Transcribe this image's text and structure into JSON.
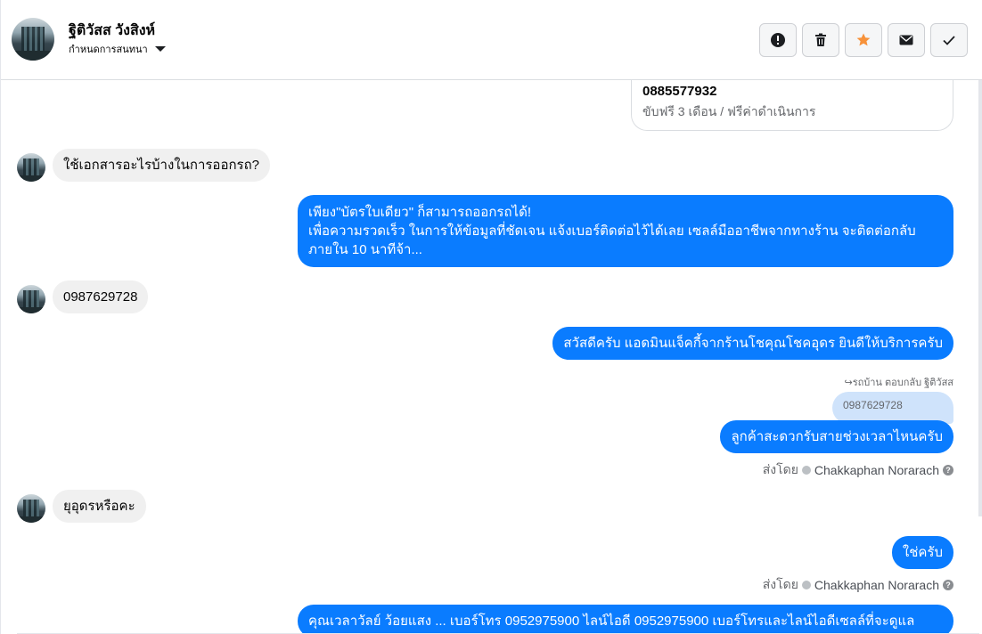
{
  "header": {
    "contact_name": "ฐิติวัสส วังสิงห์",
    "subtitle": "กำหนดการสนทนา",
    "actions": [
      {
        "name": "report-button",
        "icon": "exclamation-icon"
      },
      {
        "name": "delete-button",
        "icon": "trash-icon"
      },
      {
        "name": "star-button",
        "icon": "star-icon"
      },
      {
        "name": "mark-unread-button",
        "icon": "envelope-icon"
      },
      {
        "name": "mark-done-button",
        "icon": "check-icon"
      }
    ]
  },
  "card": {
    "phone": "0885577932",
    "desc": "ขับฟรี 3 เดือน / ฟรีค่าดำเนินการ"
  },
  "messages": {
    "m1": "ใช้เอกสารอะไรบ้างในการออกรถ?",
    "m2_line1": "เพียง\"บัตรใบเดียว\" ก็สามารถออกรถได้!",
    "m2_line2": "เพื่อความรวดเร็ว ในการให้ข้อมูลที่ชัดเจน แจ้งเบอร์ติดต่อไว้ได้เลย เซลล์มืออาชีพจากทางร้าน จะติดต่อกลับ",
    "m2_line3": "ภายใน 10 นาทีจ้า...",
    "m3": "0987629728",
    "m4": "สวัสดีครับ แอดมินแจ็คกี้จากร้านโชคุณโชคอุดร ยินดีให้บริการครับ",
    "reply_meta": "↪รถบ้าน ตอบกลับ ฐิติวัสส",
    "quoted": "0987629728",
    "m5": "ลูกค้าสะดวกรับสายช่วงเวลาไหนครับ",
    "sent_by_label": "ส่งโดย",
    "sent_by_name": "Chakkaphan Norarach",
    "m6": "ยุอุดรหรือคะ",
    "m7": "ใช่ครับ",
    "m8": "คุณเวลาวัลย์ ว้อยแสง ... เบอร์โทร 0952975900 ไลน์ไอดี 0952975900 เบอร์โทรและไลน์ไอดีเซลล์ที่จะดูแล"
  },
  "colors": {
    "outgoing": "#0a7cff",
    "incoming": "#f0f0f0",
    "star": "#f7923a"
  }
}
